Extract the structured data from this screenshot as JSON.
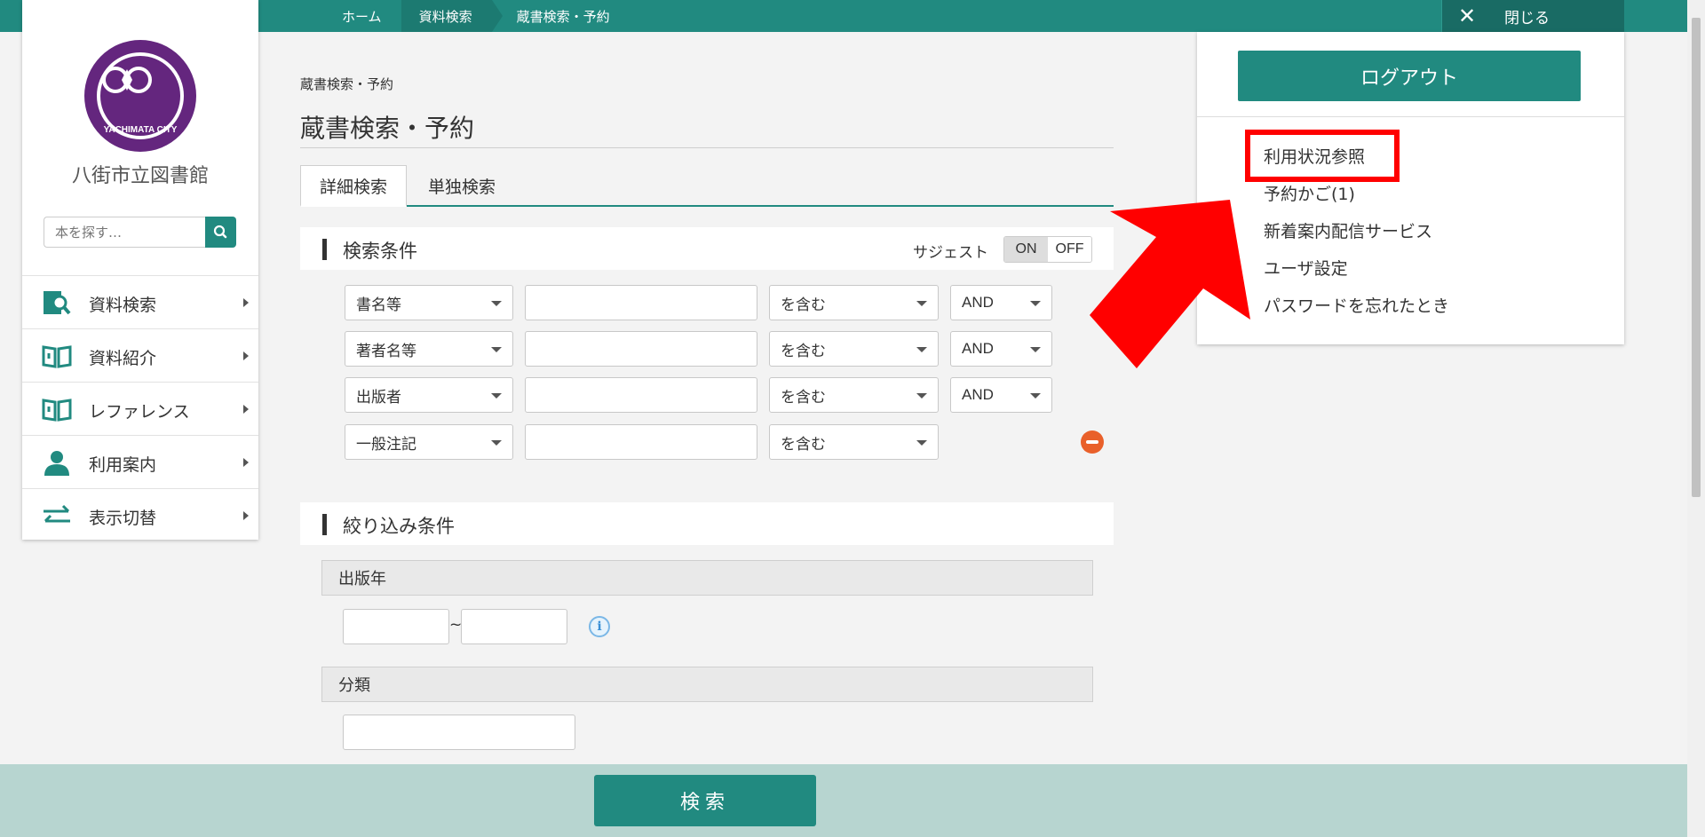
{
  "topbar": {
    "crumbs": [
      "ホーム",
      "資料検索",
      "蔵書検索・予約"
    ],
    "close_label": "閉じる"
  },
  "sidebar": {
    "logo_text": "YACHIMATA CITY",
    "library_name": "八街市立図書館",
    "search_placeholder": "本を探す…",
    "nav": [
      {
        "label": "資料検索",
        "icon": "search-book-icon"
      },
      {
        "label": "資料紹介",
        "icon": "open-book-icon"
      },
      {
        "label": "レファレンス",
        "icon": "open-book-icon"
      },
      {
        "label": "利用案内",
        "icon": "person-icon"
      },
      {
        "label": "表示切替",
        "icon": "swap-arrows-icon"
      }
    ]
  },
  "main": {
    "breadcrumb": "蔵書検索・予約",
    "title": "蔵書検索・予約",
    "tabs": [
      "詳細検索",
      "単独検索"
    ],
    "conditions": {
      "heading": "検索条件",
      "suggest_label": "サジェスト",
      "suggest_on": "ON",
      "suggest_off": "OFF",
      "rows": [
        {
          "field": "書名等",
          "value": "",
          "match": "を含む",
          "op": "AND"
        },
        {
          "field": "著者名等",
          "value": "",
          "match": "を含む",
          "op": "AND"
        },
        {
          "field": "出版者",
          "value": "",
          "match": "を含む",
          "op": "AND"
        },
        {
          "field": "一般注記",
          "value": "",
          "match": "を含む",
          "op": ""
        }
      ]
    },
    "filters": {
      "heading": "絞り込み条件",
      "year_label": "出版年",
      "year_from": "",
      "year_to": "",
      "range_sep": "~",
      "class_label": "分類",
      "class_value": ""
    },
    "search_button": "検索"
  },
  "panel": {
    "logout": "ログアウト",
    "items": [
      "利用状況参照",
      "予約かご(1)",
      "新着案内配信サービス",
      "ユーザ設定",
      "パスワードを忘れたとき"
    ]
  },
  "colors": {
    "accent": "#218a80",
    "highlight": "#ff0000",
    "logo": "#64267e"
  }
}
